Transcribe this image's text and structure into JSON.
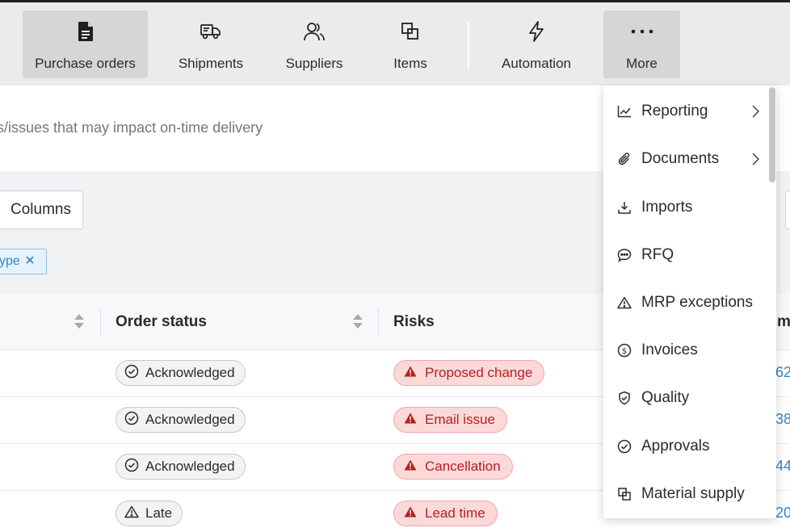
{
  "nav": {
    "items": [
      {
        "label": "Purchase orders",
        "icon": "document-icon"
      },
      {
        "label": "Shipments",
        "icon": "truck-icon"
      },
      {
        "label": "Suppliers",
        "icon": "users-icon"
      },
      {
        "label": "Items",
        "icon": "items-icon"
      },
      {
        "label": "Automation",
        "icon": "lightning-icon"
      },
      {
        "label": "More",
        "icon": "more-icon"
      }
    ],
    "active": "Purchase orders"
  },
  "subtitle": "s/issues that may impact on-time delivery",
  "toolbar": {
    "columns_label": "Columns",
    "filter_chip_label": "ype"
  },
  "table": {
    "headers": {
      "order_status": "Order status",
      "risks": "Risks",
      "edge": "m"
    },
    "rows": [
      {
        "status": "Acknowledged",
        "status_icon": "check-circle-icon",
        "risk": "Proposed change",
        "edge": "62"
      },
      {
        "status": "Acknowledged",
        "status_icon": "check-circle-icon",
        "risk": "Email issue",
        "edge": "38"
      },
      {
        "status": "Acknowledged",
        "status_icon": "check-circle-icon",
        "risk": "Cancellation",
        "edge": "44"
      },
      {
        "status": "Late",
        "status_icon": "warning-icon",
        "risk": "Lead time",
        "edge": "20"
      }
    ]
  },
  "menu": {
    "items": [
      {
        "label": "Reporting",
        "icon": "chart-icon",
        "submenu": true
      },
      {
        "label": "Documents",
        "icon": "paperclip-icon",
        "submenu": true
      },
      {
        "label": "Imports",
        "icon": "download-icon",
        "submenu": false
      },
      {
        "label": "RFQ",
        "icon": "chat-icon",
        "submenu": false
      },
      {
        "label": "MRP exceptions",
        "icon": "warning-icon",
        "submenu": false
      },
      {
        "label": "Invoices",
        "icon": "dollar-icon",
        "submenu": false
      },
      {
        "label": "Quality",
        "icon": "shield-icon",
        "submenu": false
      },
      {
        "label": "Approvals",
        "icon": "check-circle-icon",
        "submenu": false
      },
      {
        "label": "Material supply",
        "icon": "items-icon",
        "submenu": false
      }
    ]
  },
  "colors": {
    "accent_link": "#2f86c8",
    "risk_text": "#b32121",
    "risk_bg": "#fbd9d9",
    "nav_bg": "#ebebeb",
    "nav_active_bg": "#d6d6d6"
  }
}
